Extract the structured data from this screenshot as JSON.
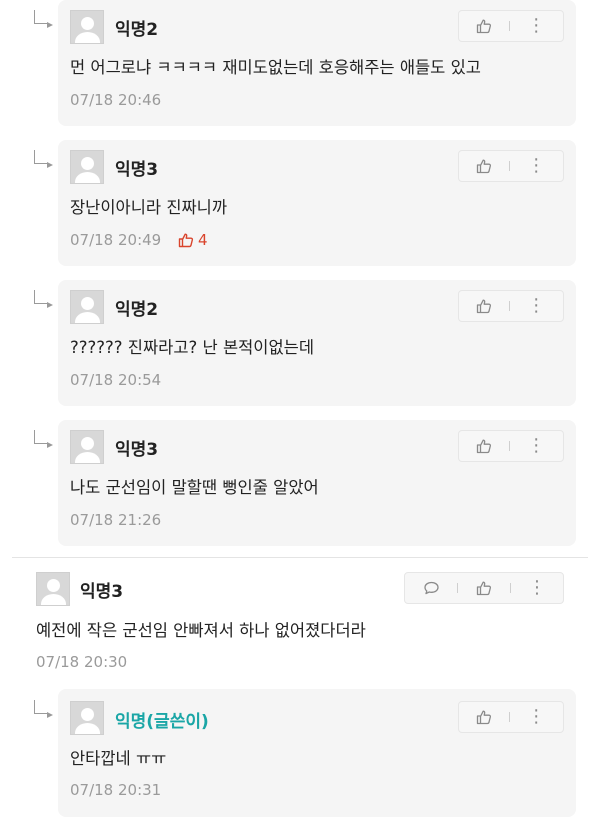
{
  "comments": [
    {
      "type": "reply",
      "name": "익명2",
      "content": "먼 어그로냐 ㅋㅋㅋㅋ 재미도없는데 호응해주는 애들도 있고",
      "date": "07/18 20:46",
      "likes": ""
    },
    {
      "type": "reply",
      "name": "익명3",
      "content": "장난이아니라 진짜니까",
      "date": "07/18 20:49",
      "likes": "4"
    },
    {
      "type": "reply",
      "name": "익명2",
      "content": "?????? 진짜라고? 난 본적이없는데",
      "date": "07/18 20:54",
      "likes": ""
    },
    {
      "type": "reply",
      "name": "익명3",
      "content": "나도 군선임이 말할땐 뻥인줄 알았어",
      "date": "07/18 21:26",
      "likes": ""
    },
    {
      "type": "comment",
      "name": "익명3",
      "content": "예전에 작은 군선임 안빠져서 하나 없어졌다더라",
      "date": "07/18 20:30"
    },
    {
      "type": "reply",
      "name": "익명(글쓴이)",
      "content": "안타깝네 ㅠㅠ",
      "date": "07/18 20:31",
      "is_author": true
    }
  ],
  "colors": {
    "author_name": "#1aa6a6",
    "like_active": "#d9442c",
    "card_bg": "#f5f5f5"
  },
  "icons": {
    "like": "thumbs-up-icon",
    "more": "kebab-icon",
    "reply": "speech-bubble-icon",
    "reply_arrow": "reply-arrow-icon"
  }
}
